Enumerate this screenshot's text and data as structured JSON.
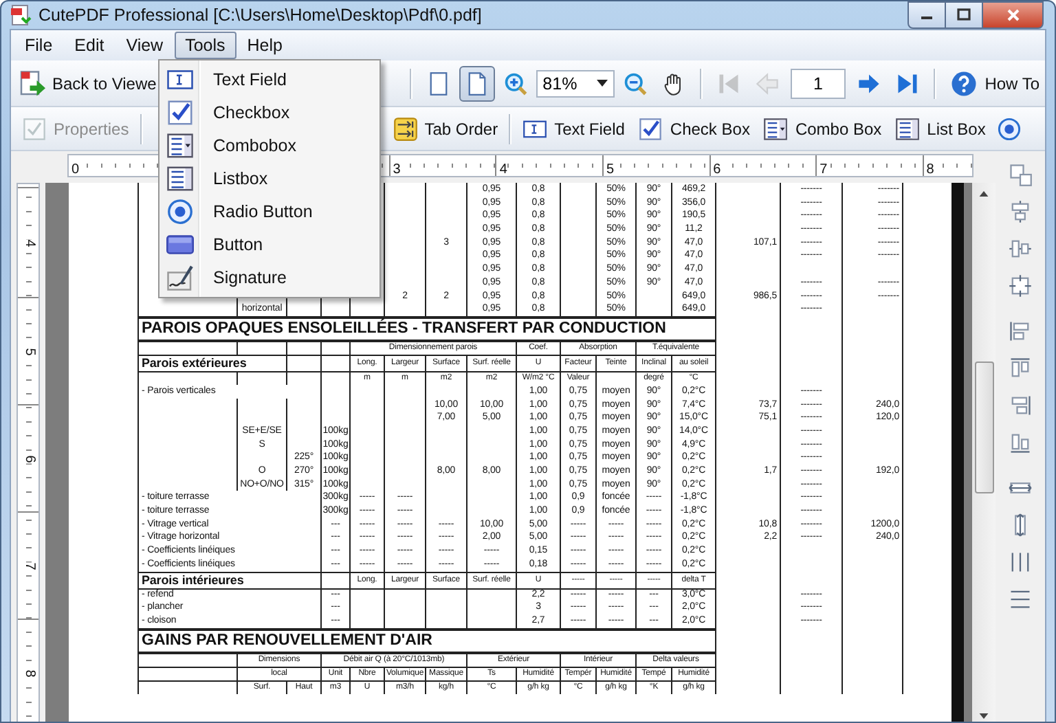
{
  "window": {
    "title": "CutePDF Professional [C:\\Users\\Home\\Desktop\\Pdf\\0.pdf]"
  },
  "menus": [
    {
      "label": "File",
      "selected": false
    },
    {
      "label": "Edit",
      "selected": false
    },
    {
      "label": "View",
      "selected": false
    },
    {
      "label": "Tools",
      "selected": true
    },
    {
      "label": "Help",
      "selected": false
    }
  ],
  "tools_menu": [
    {
      "label": "Text Field",
      "kind": "text-field"
    },
    {
      "label": "Checkbox",
      "kind": "checkbox"
    },
    {
      "label": "Combobox",
      "kind": "combobox"
    },
    {
      "label": "Listbox",
      "kind": "listbox"
    },
    {
      "label": "Radio Button",
      "kind": "radio"
    },
    {
      "label": "Button",
      "kind": "button"
    },
    {
      "label": "Signature",
      "kind": "signature"
    }
  ],
  "toolbar_1": [
    {
      "kind": "back",
      "label": "Back to Viewe",
      "disabled": false
    },
    {
      "kind": "separator"
    },
    {
      "kind": "page-single",
      "disabled": false,
      "selected": false
    },
    {
      "kind": "page-facing",
      "disabled": false,
      "selected": true
    },
    {
      "kind": "zoom-in",
      "disabled": false
    },
    {
      "kind": "zoom-combo",
      "value": "81%",
      "disabled": false
    },
    {
      "kind": "zoom-out",
      "disabled": false
    },
    {
      "kind": "hand",
      "disabled": false
    },
    {
      "kind": "separator"
    },
    {
      "kind": "first",
      "disabled": true
    },
    {
      "kind": "previous",
      "disabled": true
    },
    {
      "kind": "page-field",
      "value": "1",
      "disabled": false
    },
    {
      "kind": "next",
      "disabled": false
    },
    {
      "kind": "last",
      "disabled": false
    },
    {
      "kind": "separator"
    },
    {
      "kind": "help",
      "label": "How To",
      "disabled": false
    }
  ],
  "toolbar_2": [
    {
      "kind": "properties",
      "label": "Properties",
      "disabled": true
    },
    {
      "kind": "separator"
    },
    {
      "kind": "tab-order",
      "label": "Tab Order",
      "disabled": false
    },
    {
      "kind": "separator"
    },
    {
      "kind": "text-field",
      "label": "Text Field",
      "disabled": false
    },
    {
      "kind": "checkbox",
      "label": "Check Box",
      "disabled": false
    },
    {
      "kind": "combobox",
      "label": "Combo Box",
      "disabled": false
    },
    {
      "kind": "listbox",
      "label": "List Box",
      "disabled": false
    },
    {
      "kind": "radio",
      "disabled": false
    }
  ],
  "ruler_h": [
    {
      "label": "0"
    },
    {
      "label": "3"
    },
    {
      "label": "4"
    },
    {
      "label": "5"
    },
    {
      "label": "6"
    },
    {
      "label": "7"
    },
    {
      "label": "8"
    }
  ],
  "ruler_v": [
    {
      "label": "4"
    },
    {
      "label": "5"
    },
    {
      "label": "6"
    },
    {
      "label": "7"
    },
    {
      "label": "8"
    }
  ],
  "document": {
    "rows": [
      {
        "kind": "data",
        "cells": {
          "c8": "0,95",
          "c9": "0,8",
          "c11": "50%",
          "c12": "90°",
          "c13": "469,2",
          "c15": "-------",
          "c16": "-------"
        }
      },
      {
        "kind": "data",
        "cells": {
          "c8": "0,95",
          "c9": "0,8",
          "c11": "50%",
          "c12": "90°",
          "c13": "356,0",
          "c15": "-------",
          "c16": "-------"
        }
      },
      {
        "kind": "data",
        "cells": {
          "c8": "0,95",
          "c9": "0,8",
          "c11": "50%",
          "c12": "90°",
          "c13": "190,5",
          "c15": "-------",
          "c16": "-------"
        }
      },
      {
        "kind": "data",
        "cells": {
          "c8": "0,95",
          "c9": "0,8",
          "c11": "50%",
          "c12": "90°",
          "c13": "11,2",
          "c15": "-------",
          "c16": "-------"
        }
      },
      {
        "kind": "data",
        "cells": {
          "c7": "3",
          "c8": "0,95",
          "c9": "0,8",
          "c11": "50%",
          "c12": "90°",
          "c13": "47,0",
          "c14": "107,1",
          "c15": "-------",
          "c16": "-------"
        }
      },
      {
        "kind": "data",
        "cells": {
          "c8": "0,95",
          "c9": "0,8",
          "c11": "50%",
          "c12": "90°",
          "c13": "47,0",
          "c15": "-------",
          "c16": "-------"
        }
      },
      {
        "kind": "data",
        "cells": {
          "c8": "0,95",
          "c9": "0,8",
          "c11": "50%",
          "c12": "90°",
          "c13": "47,0"
        }
      },
      {
        "kind": "data",
        "cells": {
          "c8": "0,95",
          "c9": "0,8",
          "c11": "50%",
          "c12": "90°",
          "c13": "47,0",
          "c15": "-------",
          "c16": "-------"
        }
      },
      {
        "kind": "data",
        "cells": {
          "c6": "2",
          "c7": "2",
          "c8": "0,95",
          "c9": "0,8",
          "c11": "50%",
          "c13": "649,0",
          "c14": "986,5",
          "c15": "-------",
          "c16": "-------"
        }
      },
      {
        "kind": "data",
        "cells": {
          "c2": "horizontal",
          "c8": "0,95",
          "c9": "0,8",
          "c11": "50%",
          "c13": "649,0",
          "c15": "-------"
        }
      },
      {
        "kind": "title",
        "cells": {
          "c1-c13": "PAROIS OPAQUES ENSOLEILLÉES - TRANSFERT PAR CONDUCTION"
        }
      },
      {
        "kind": "header",
        "cells": {
          "c5-c8": "Dimensionnement parois",
          "c9": "Coef.",
          "c10-c11": "Absorption",
          "c12-c13": "T.équivalente"
        }
      },
      {
        "kind": "group",
        "cells": {
          "c1-c2": "Parois extérieures",
          "c5": "Long.",
          "c6": "Largeur",
          "c7": "Surface",
          "c8": "Surf. réelle",
          "c9": "U",
          "c10": "Facteur",
          "c11": "Teinte",
          "c12": "Inclinal",
          "c13": "au soleil"
        }
      },
      {
        "kind": "header",
        "cells": {
          "c5": "m",
          "c6": "m",
          "c7": "m2",
          "c8": "m2",
          "c9": "W/m2 °C",
          "c10": "Valeur",
          "c12": "degré",
          "c13": "°C"
        }
      },
      {
        "kind": "data",
        "cells": {
          "c1-c3": "- Parois verticales",
          "c9": "1,00",
          "c10": "0,75",
          "c11": "moyen",
          "c12": "90°",
          "c13": "0,2°C",
          "c15": "-------"
        }
      },
      {
        "kind": "data",
        "cells": {
          "c7": "10,00",
          "c8": "10,00",
          "c9": "1,00",
          "c10": "0,75",
          "c11": "moyen",
          "c12": "90°",
          "c13": "7,4°C",
          "c14": "73,7",
          "c15": "-------",
          "c16": "240,0"
        }
      },
      {
        "kind": "data",
        "cells": {
          "c7": "7,00",
          "c8": "5,00",
          "c9": "1,00",
          "c10": "0,75",
          "c11": "moyen",
          "c12": "90°",
          "c13": "15,0°C",
          "c14": "75,1",
          "c15": "-------",
          "c16": "120,0"
        }
      },
      {
        "kind": "data",
        "cells": {
          "c2": "SE+E/SE",
          "c4": "100kg",
          "c9": "1,00",
          "c10": "0,75",
          "c11": "moyen",
          "c12": "90°",
          "c13": "14,0°C",
          "c15": "-------"
        }
      },
      {
        "kind": "data",
        "cells": {
          "c2": "S",
          "c4": "100kg",
          "c9": "1,00",
          "c10": "0,75",
          "c11": "moyen",
          "c12": "90°",
          "c13": "4,9°C",
          "c15": "-------"
        }
      },
      {
        "kind": "data",
        "cells": {
          "c3": "225°",
          "c4": "100kg",
          "c9": "1,00",
          "c10": "0,75",
          "c11": "moyen",
          "c12": "90°",
          "c13": "0,2°C",
          "c15": "-------"
        }
      },
      {
        "kind": "data",
        "cells": {
          "c2": "O",
          "c3": "270°",
          "c4": "100kg",
          "c7": "8,00",
          "c8": "8,00",
          "c9": "1,00",
          "c10": "0,75",
          "c11": "moyen",
          "c12": "90°",
          "c13": "0,2°C",
          "c14": "1,7",
          "c15": "-------",
          "c16": "192,0"
        }
      },
      {
        "kind": "data",
        "cells": {
          "c2": "NO+O/NO",
          "c3": "315°",
          "c4": "100kg",
          "c9": "1,00",
          "c10": "0,75",
          "c11": "moyen",
          "c12": "90°",
          "c13": "0,2°C",
          "c15": "-------"
        }
      },
      {
        "kind": "data",
        "cells": {
          "c1-c3": "- toiture terrasse",
          "c4": "300kg",
          "c5": "-----",
          "c6": "-----",
          "c9": "1,00",
          "c10": "0,9",
          "c11": "foncée",
          "c12": "-----",
          "c13": "-1,8°C",
          "c15": "-------"
        }
      },
      {
        "kind": "data",
        "cells": {
          "c1-c3": "- toiture terrasse",
          "c4": "300kg",
          "c5": "-----",
          "c6": "-----",
          "c9": "1,00",
          "c10": "0,9",
          "c11": "foncée",
          "c12": "-----",
          "c13": "-1,8°C",
          "c15": "-------"
        }
      },
      {
        "kind": "data",
        "cells": {
          "c1-c3": "- Vitrage vertical",
          "c4": "---",
          "c5": "-----",
          "c6": "-----",
          "c7": "-----",
          "c8": "10,00",
          "c9": "5,00",
          "c10": "-----",
          "c11": "-----",
          "c12": "-----",
          "c13": "0,2°C",
          "c14": "10,8",
          "c15": "-------",
          "c16": "1200,0"
        }
      },
      {
        "kind": "data",
        "cells": {
          "c1-c3": "- Vitrage horizontal",
          "c4": "---",
          "c5": "-----",
          "c6": "-----",
          "c7": "-----",
          "c8": "2,00",
          "c9": "5,00",
          "c10": "-----",
          "c11": "-----",
          "c12": "-----",
          "c13": "0,2°C",
          "c14": "2,2",
          "c15": "-------",
          "c16": "240,0"
        }
      },
      {
        "kind": "data",
        "cells": {
          "c1-c3": "- Coefficients linéiques",
          "c4": "---",
          "c5": "-----",
          "c6": "-----",
          "c7": "-----",
          "c8": "-----",
          "c9": "0,15",
          "c10": "-----",
          "c11": "-----",
          "c12": "-----",
          "c13": "0,2°C"
        }
      },
      {
        "kind": "data",
        "cells": {
          "c1-c3": "- Coefficients linéiques",
          "c4": "---",
          "c5": "-----",
          "c6": "-----",
          "c7": "-----",
          "c8": "-----",
          "c9": "0,18",
          "c10": "-----",
          "c11": "-----",
          "c12": "-----",
          "c13": "0,2°C"
        }
      },
      {
        "kind": "group",
        "cells": {
          "c1-c3": "Parois intérieures",
          "c5": "Long.",
          "c6": "Largeur",
          "c7": "Surface",
          "c8": "Surf. réelle",
          "c9": "U",
          "c10": "-----",
          "c11": "-----",
          "c12": "-----",
          "c13": "delta T"
        }
      },
      {
        "kind": "data",
        "cells": {
          "c1-c3": "- refend",
          "c4": "---",
          "c9": "2,2",
          "c10": "-----",
          "c11": "-----",
          "c12": "---",
          "c13": "3,0°C",
          "c15": "-------"
        }
      },
      {
        "kind": "data",
        "cells": {
          "c1-c3": "- plancher",
          "c4": "---",
          "c9": "3",
          "c10": "-----",
          "c11": "-----",
          "c12": "---",
          "c13": "2,0°C",
          "c15": "-------"
        }
      },
      {
        "kind": "data",
        "cells": {
          "c1-c3": "- cloison",
          "c4": "---",
          "c9": "2,7",
          "c10": "-----",
          "c11": "-----",
          "c12": "---",
          "c13": "2,0°C",
          "c15": "-------"
        }
      },
      {
        "kind": "title",
        "cells": {
          "c1-c13": "GAINS PAR RENOUVELLEMENT D'AIR"
        }
      },
      {
        "kind": "header",
        "cells": {
          "c2-c3": "Dimensions",
          "c4-c7": "Débit air Q (à 20°C/1013mb)",
          "c8-c9": "Extérieur",
          "c10-c11": "Intérieur",
          "c12-c13": "Delta valeurs"
        }
      },
      {
        "kind": "header",
        "cells": {
          "c2-c3": "local",
          "c4": "Unit",
          "c5": "Nbre",
          "c6": "Volumique",
          "c7": "Massique",
          "c8": "Ts",
          "c9": "Humidité",
          "c10": "Tempér",
          "c11": "Humidité",
          "c12": "Tempé",
          "c13": "Humidité"
        }
      },
      {
        "kind": "header",
        "cells": {
          "c2": "Surf.",
          "c3": "Haut",
          "c4": "m3",
          "c5": "U",
          "c6": "m3/h",
          "c7": "kg/h",
          "c8": "°C",
          "c9": "g/h kg",
          "c10": "°C",
          "c11": "g/h kg",
          "c12": "°K",
          "c13": "g/h kg"
        }
      }
    ]
  }
}
